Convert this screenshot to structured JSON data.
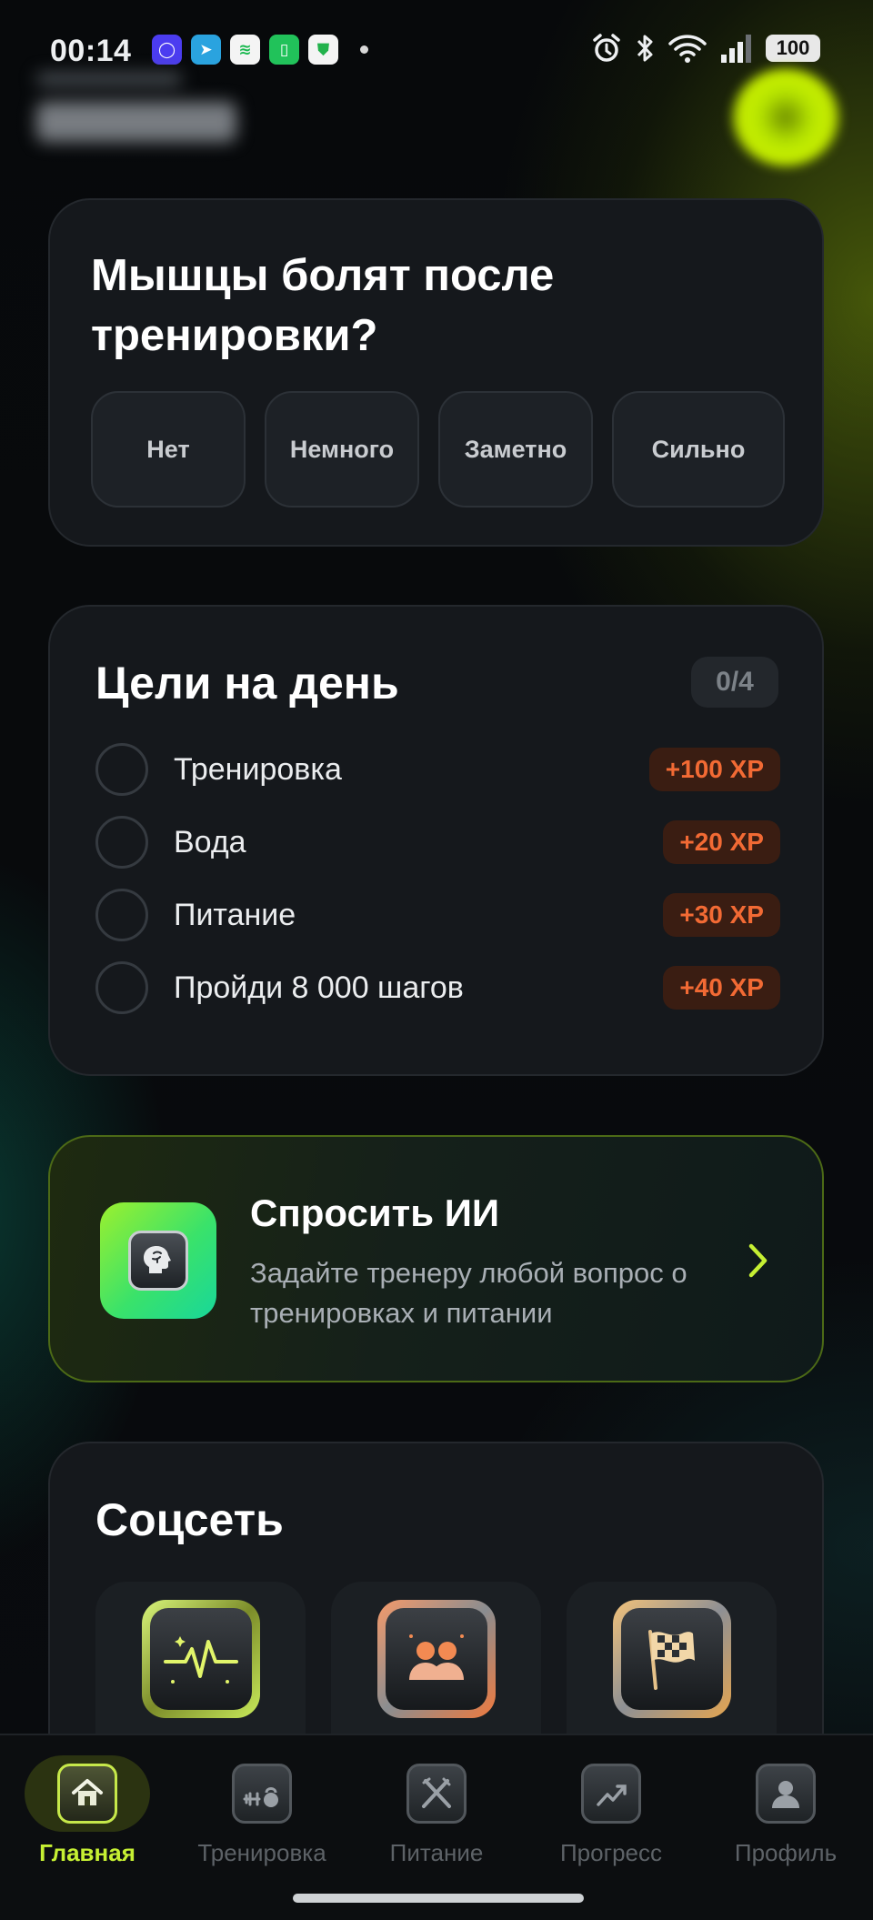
{
  "status_bar": {
    "time": "00:14",
    "battery": "100",
    "notification_icons": [
      "messenger-icon",
      "telegram-icon",
      "spotify-icon",
      "battery-app-icon",
      "shield-icon"
    ],
    "system_icons": [
      "alarm-icon",
      "bluetooth-icon",
      "wifi-icon",
      "signal-icon",
      "battery-icon"
    ]
  },
  "soreness": {
    "title": "Мышцы болят после тренировки?",
    "options": [
      "Нет",
      "Немного",
      "Заметно",
      "Сильно"
    ]
  },
  "goals": {
    "title": "Цели на день",
    "counter": "0/4",
    "items": [
      {
        "label": "Тренировка",
        "xp": "+100 XP",
        "done": false
      },
      {
        "label": "Вода",
        "xp": "+20 XP",
        "done": false
      },
      {
        "label": "Питание",
        "xp": "+30 XP",
        "done": false
      },
      {
        "label": "Пройди 8 000 шагов",
        "xp": "+40 XP",
        "done": false
      }
    ]
  },
  "ask_ai": {
    "title": "Спросить ИИ",
    "description": "Задайте тренеру любой вопрос о тренировках и питании",
    "icon": "brain-icon"
  },
  "social": {
    "title": "Соцсеть",
    "tiles": [
      {
        "icon": "activity-icon"
      },
      {
        "icon": "friends-icon"
      },
      {
        "icon": "checkered-flag-icon"
      }
    ]
  },
  "nav": {
    "active": "home",
    "items": [
      {
        "id": "home",
        "label": "Главная",
        "icon": "home-icon"
      },
      {
        "id": "workout",
        "label": "Тренировка",
        "icon": "dumbbell-kettlebell-icon"
      },
      {
        "id": "nutrition",
        "label": "Питание",
        "icon": "fork-knife-icon"
      },
      {
        "id": "progress",
        "label": "Прогресс",
        "icon": "trend-chart-icon"
      },
      {
        "id": "profile",
        "label": "Профиль",
        "icon": "person-icon"
      }
    ]
  },
  "colors": {
    "accent_lime": "#c6f033",
    "xp_orange": "#f26a34",
    "card_bg": "#15181c"
  }
}
